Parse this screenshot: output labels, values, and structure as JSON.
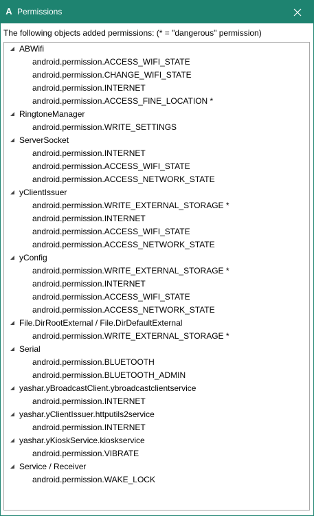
{
  "window": {
    "app_icon": "A",
    "title": "Permissions",
    "close_icon": "close-icon"
  },
  "description": "The following objects added permissions: (* = \"dangerous\" permission)",
  "groups": [
    {
      "name": "ABWifi",
      "permissions": [
        "android.permission.ACCESS_WIFI_STATE",
        "android.permission.CHANGE_WIFI_STATE",
        "android.permission.INTERNET",
        "android.permission.ACCESS_FINE_LOCATION *"
      ]
    },
    {
      "name": "RingtoneManager",
      "permissions": [
        "android.permission.WRITE_SETTINGS"
      ]
    },
    {
      "name": "ServerSocket",
      "permissions": [
        "android.permission.INTERNET",
        "android.permission.ACCESS_WIFI_STATE",
        "android.permission.ACCESS_NETWORK_STATE"
      ]
    },
    {
      "name": "yClientIssuer",
      "permissions": [
        "android.permission.WRITE_EXTERNAL_STORAGE *",
        "android.permission.INTERNET",
        "android.permission.ACCESS_WIFI_STATE",
        "android.permission.ACCESS_NETWORK_STATE"
      ]
    },
    {
      "name": "yConfig",
      "permissions": [
        "android.permission.WRITE_EXTERNAL_STORAGE *",
        "android.permission.INTERNET",
        "android.permission.ACCESS_WIFI_STATE",
        "android.permission.ACCESS_NETWORK_STATE"
      ]
    },
    {
      "name": "File.DirRootExternal / File.DirDefaultExternal",
      "permissions": [
        "android.permission.WRITE_EXTERNAL_STORAGE *"
      ]
    },
    {
      "name": "Serial",
      "permissions": [
        "android.permission.BLUETOOTH",
        "android.permission.BLUETOOTH_ADMIN"
      ]
    },
    {
      "name": "yashar.yBroadcastClient.ybroadcastclientservice",
      "permissions": [
        "android.permission.INTERNET"
      ]
    },
    {
      "name": "yashar.yClientIssuer.httputils2service",
      "permissions": [
        "android.permission.INTERNET"
      ]
    },
    {
      "name": "yashar.yKioskService.kioskservice",
      "permissions": [
        "android.permission.VIBRATE"
      ]
    },
    {
      "name": "Service / Receiver",
      "permissions": [
        "android.permission.WAKE_LOCK"
      ]
    }
  ]
}
